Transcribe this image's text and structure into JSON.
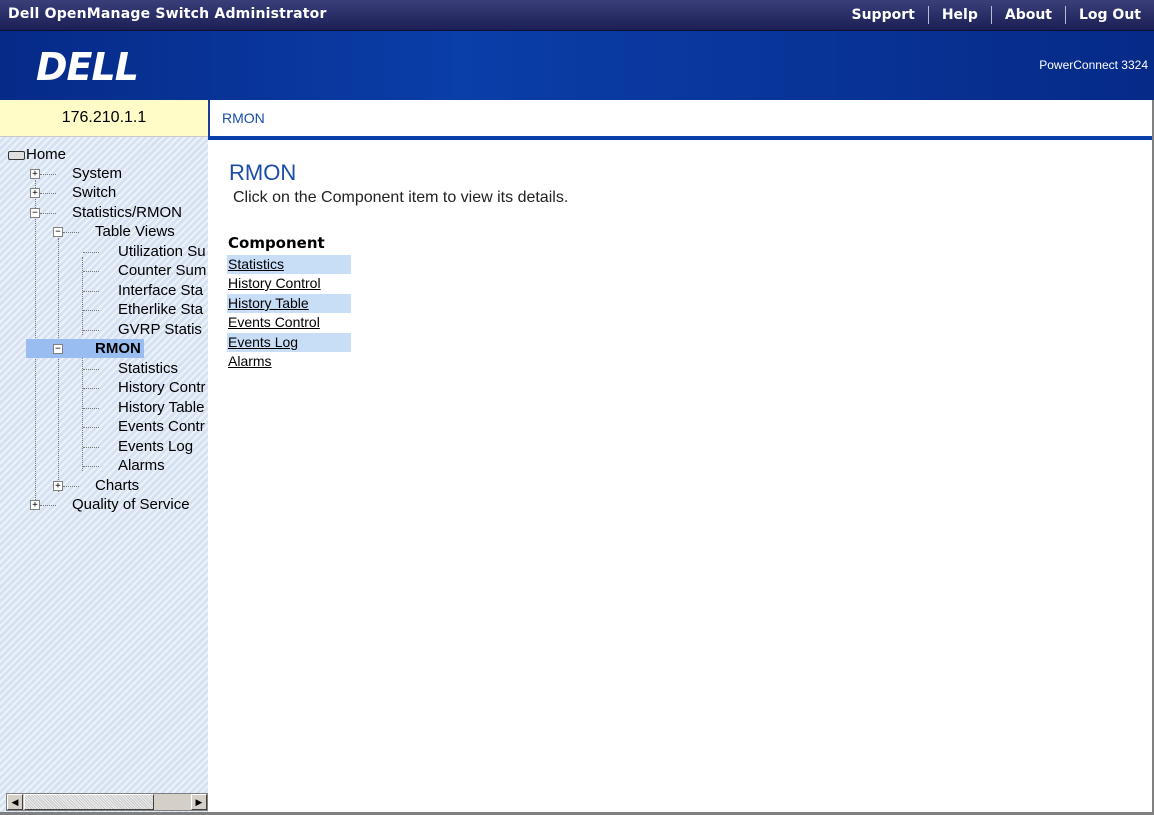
{
  "app_title": "Dell OpenManage Switch Administrator",
  "topnav": [
    "Support",
    "Help",
    "About",
    "Log Out"
  ],
  "logo_text": "DELL",
  "product": "PowerConnect 3324",
  "ip": "176.210.1.1",
  "breadcrumb": "RMON",
  "sidebar": {
    "home": "Home",
    "system": "System",
    "switch": "Switch",
    "stats_rmon": "Statistics/RMON",
    "table_views": "Table Views",
    "tv_items": [
      "Utilization Su",
      "Counter Sum",
      "Interface Sta",
      "Etherlike Sta",
      "GVRP Statis"
    ],
    "rmon": "RMON",
    "rmon_items": [
      "Statistics",
      "History Contr",
      "History Table",
      "Events Contr",
      "Events Log",
      "Alarms"
    ],
    "charts": "Charts",
    "qos": "Quality of Service"
  },
  "main": {
    "title": "RMON",
    "description": "Click on the Component item to view its details.",
    "component_header": "Component",
    "components": [
      "Statistics",
      "History Control",
      "History Table",
      "Events Control",
      "Events Log",
      "Alarms"
    ]
  },
  "colors": {
    "banner": "#0a3ea8",
    "accent_text": "#1a4ca8",
    "ip_bg": "#fffcc8",
    "row_highlight": "#c8ddf6",
    "selected": "#99bdf0"
  }
}
